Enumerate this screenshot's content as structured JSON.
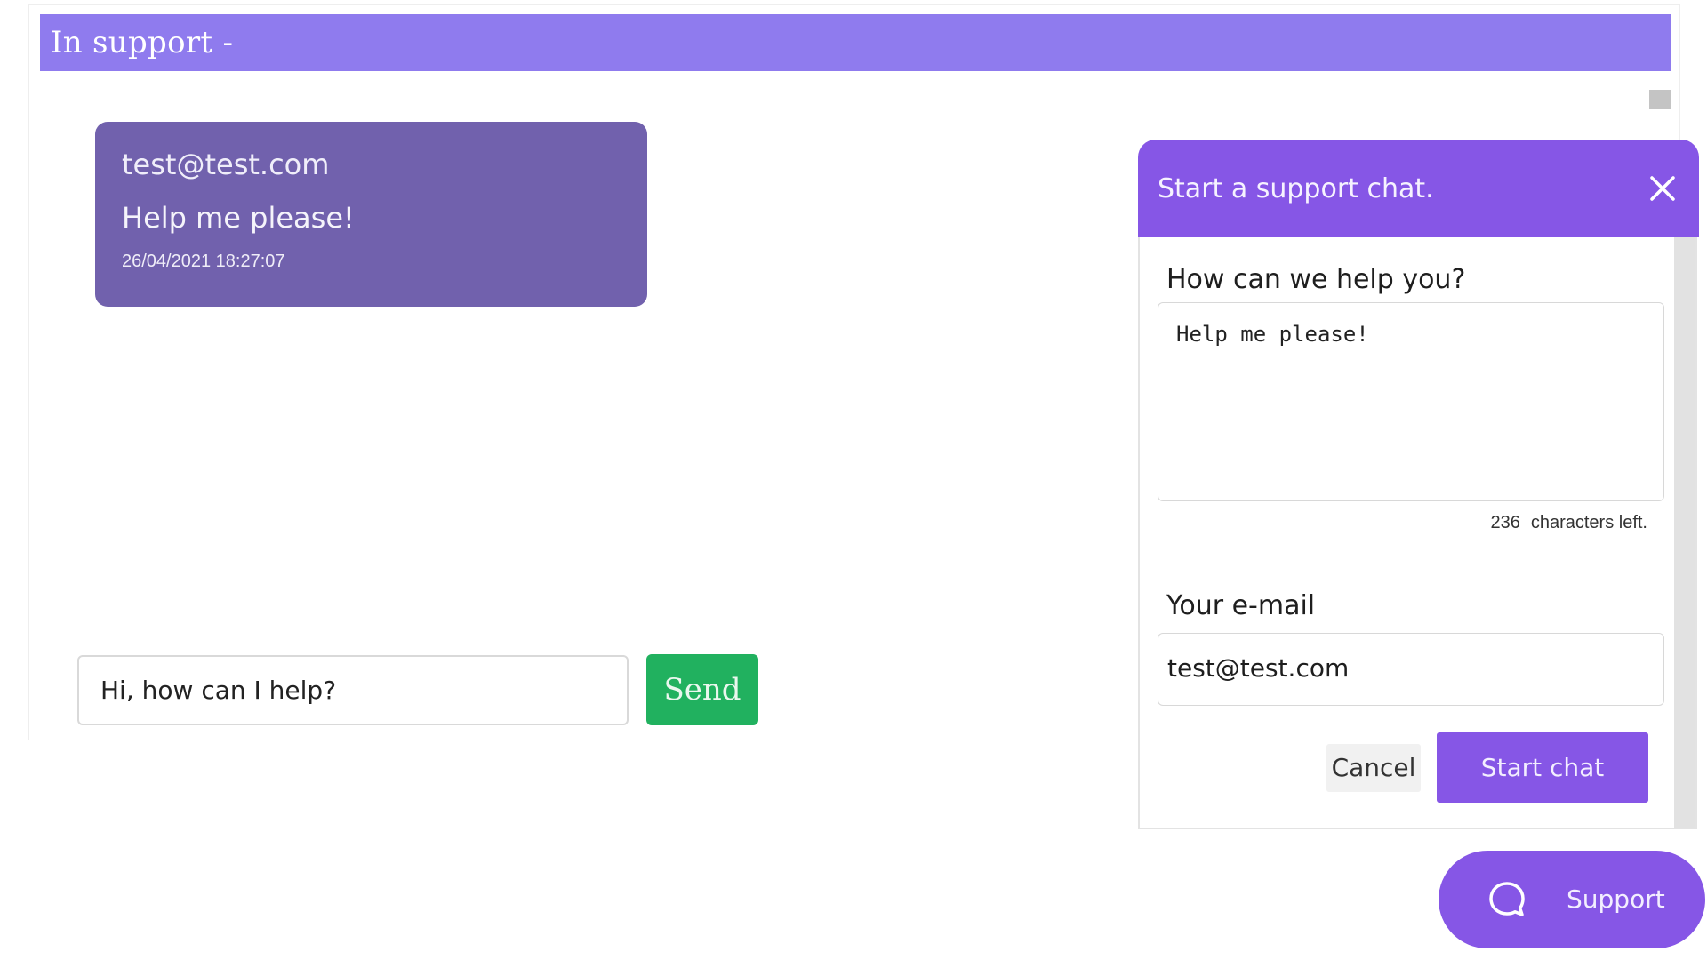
{
  "panel": {
    "title": "In support -"
  },
  "message": {
    "sender": "test@test.com",
    "text": "Help me please!",
    "timestamp": "26/04/2021 18:27:07"
  },
  "reply": {
    "value": "Hi, how can I help?",
    "send_label": "Send"
  },
  "widget": {
    "title": "Start a support chat.",
    "close_icon": "close-icon",
    "help_label": "How can we help you?",
    "help_value": "Help me please!",
    "chars_left": "236",
    "chars_left_suffix": "characters left.",
    "email_label": "Your e-mail",
    "email_value": "test@test.com",
    "cancel_label": "Cancel",
    "start_label": "Start chat"
  },
  "fab": {
    "label": "Support",
    "icon": "chat-bubble-icon"
  },
  "colors": {
    "header_bar": "#8f7bee",
    "bubble": "#7161ad",
    "send_button": "#21b15f",
    "widget_accent": "#8656e6"
  }
}
